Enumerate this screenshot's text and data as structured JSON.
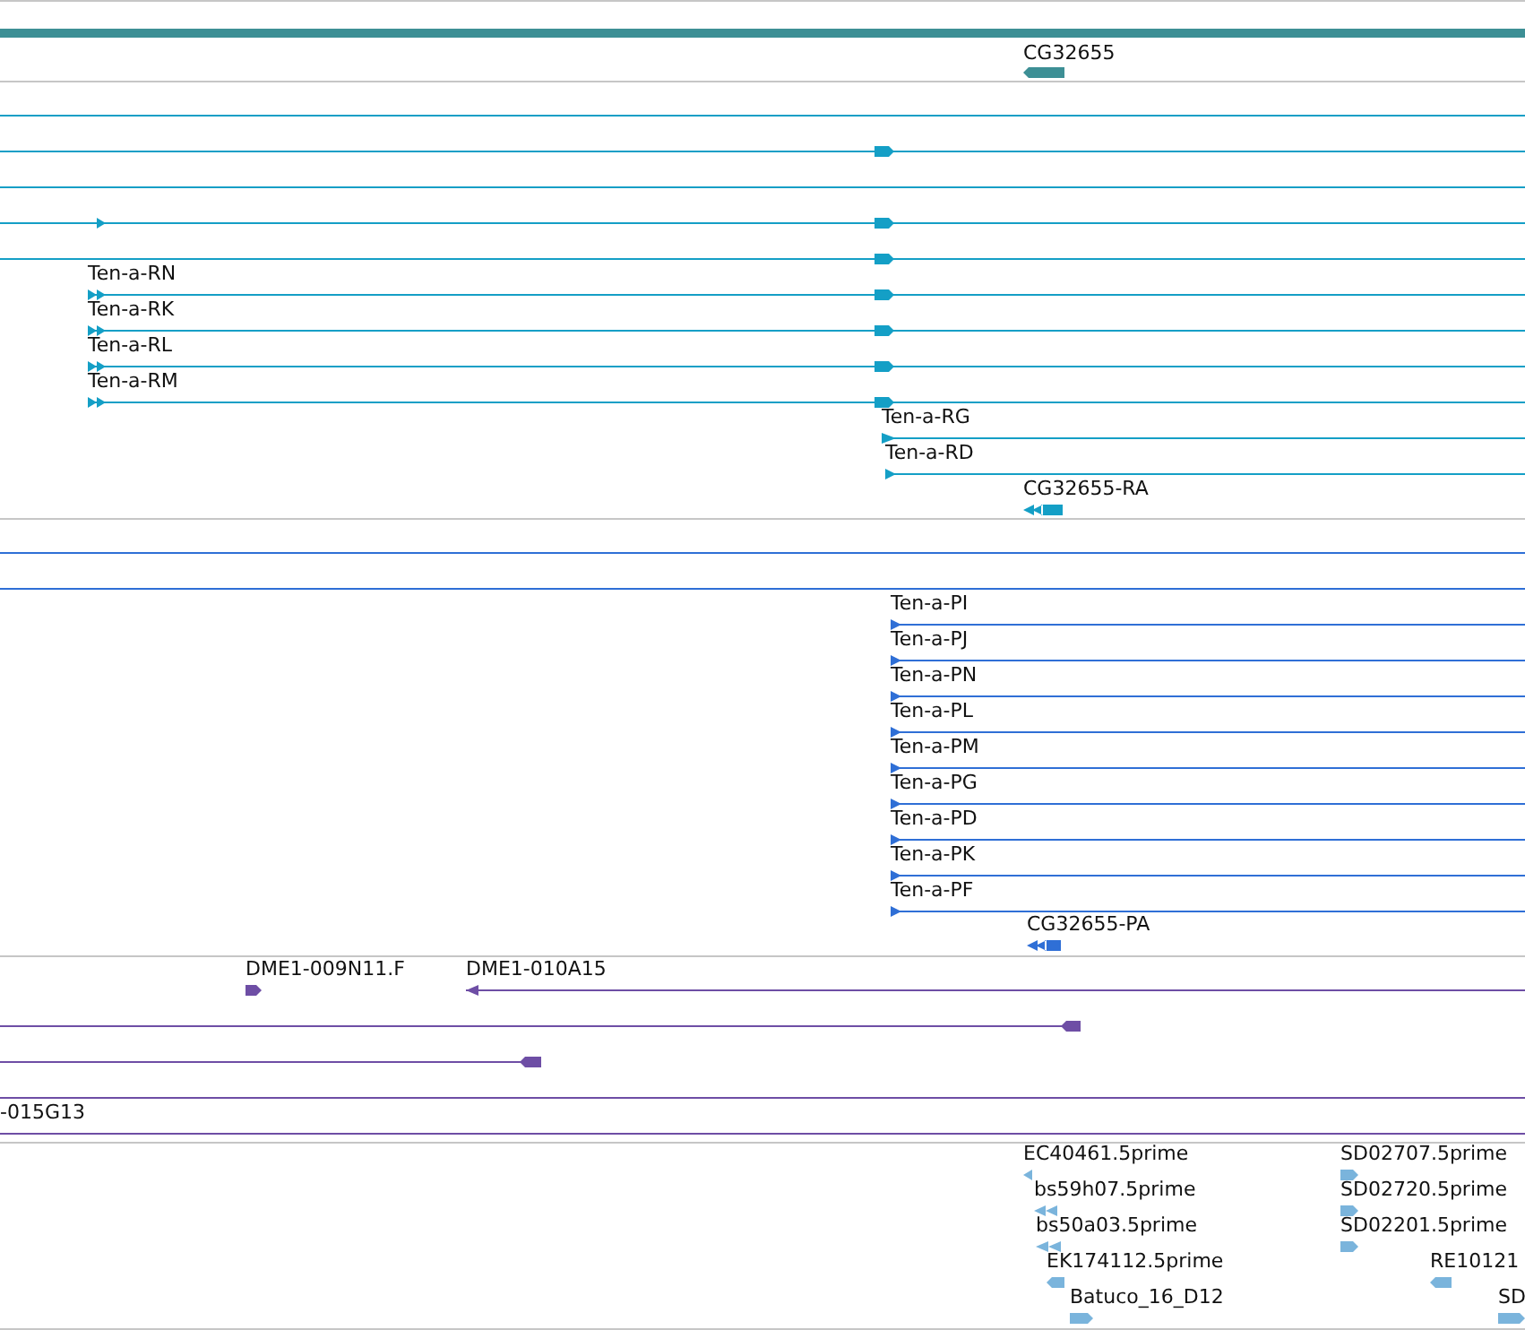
{
  "tracks": [
    {
      "color": "#3d8f95",
      "features": [
        {
          "kind": "bar"
        },
        {
          "kind": "glyph",
          "label": "CG32655"
        }
      ]
    },
    {
      "color": "#149fc6",
      "features": [
        {
          "kind": "line"
        },
        {
          "kind": "line"
        },
        {
          "kind": "line"
        },
        {
          "kind": "line"
        },
        {
          "kind": "line"
        },
        {
          "kind": "line",
          "label": "Ten-a-RN"
        },
        {
          "kind": "line",
          "label": "Ten-a-RK"
        },
        {
          "kind": "line",
          "label": "Ten-a-RL"
        },
        {
          "kind": "line",
          "label": "Ten-a-RM"
        },
        {
          "kind": "line",
          "label": "Ten-a-RG"
        },
        {
          "kind": "line",
          "label": "Ten-a-RD"
        },
        {
          "kind": "glyph",
          "label": "CG32655-RA"
        }
      ]
    },
    {
      "color": "#2f6fd6",
      "features": [
        {
          "kind": "line"
        },
        {
          "kind": "line"
        },
        {
          "kind": "line",
          "label": "Ten-a-PI"
        },
        {
          "kind": "line",
          "label": "Ten-a-PJ"
        },
        {
          "kind": "line",
          "label": "Ten-a-PN"
        },
        {
          "kind": "line",
          "label": "Ten-a-PL"
        },
        {
          "kind": "line",
          "label": "Ten-a-PM"
        },
        {
          "kind": "line",
          "label": "Ten-a-PG"
        },
        {
          "kind": "line",
          "label": "Ten-a-PD"
        },
        {
          "kind": "line",
          "label": "Ten-a-PK"
        },
        {
          "kind": "line",
          "label": "Ten-a-PF"
        },
        {
          "kind": "glyph",
          "label": "CG32655-PA"
        }
      ]
    },
    {
      "color": "#6e4ea5",
      "features": [
        {
          "kind": "glyph",
          "label": "DME1-009N11.F"
        },
        {
          "kind": "line",
          "label": "DME1-010A15"
        },
        {
          "kind": "line"
        },
        {
          "kind": "line"
        },
        {
          "kind": "line"
        },
        {
          "kind": "line",
          "label": "-015G13"
        }
      ]
    },
    {
      "color": "#7ab4dc",
      "features": [
        {
          "kind": "glyph",
          "label": "EC40461.5prime"
        },
        {
          "kind": "glyph",
          "label": "bs59h07.5prime"
        },
        {
          "kind": "glyph",
          "label": "bs50a03.5prime"
        },
        {
          "kind": "glyph",
          "label": "EK174112.5prime"
        },
        {
          "kind": "glyph",
          "label": "Batuco_16_D12"
        },
        {
          "kind": "glyph",
          "label": "SD02707.5prime"
        },
        {
          "kind": "glyph",
          "label": "SD02720.5prime"
        },
        {
          "kind": "glyph",
          "label": "SD02201.5prime"
        },
        {
          "kind": "glyph",
          "label": "RE10121"
        },
        {
          "kind": "glyph",
          "label": "SD"
        }
      ]
    }
  ]
}
